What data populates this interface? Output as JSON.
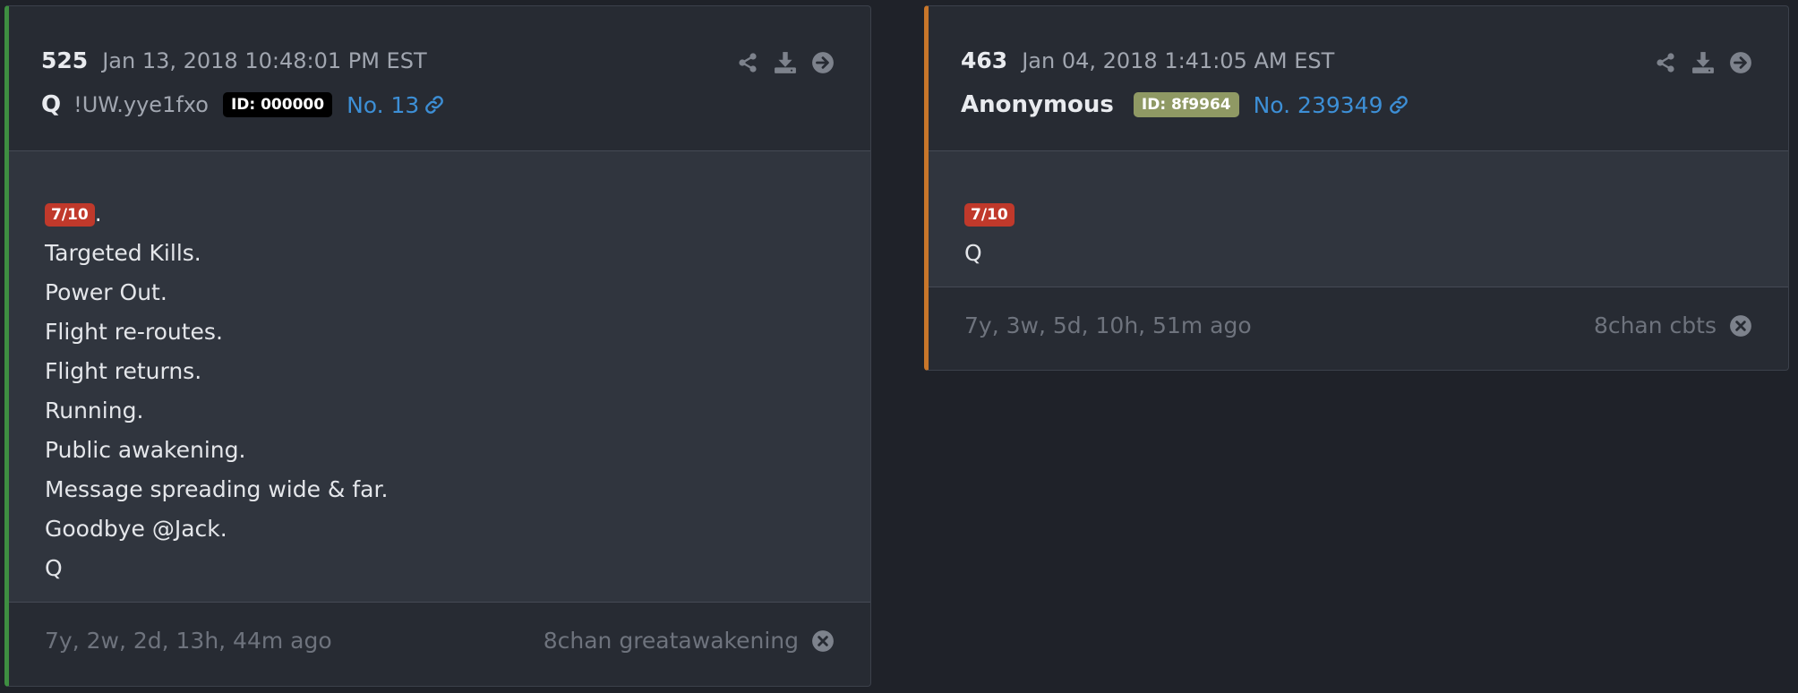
{
  "posts": [
    {
      "number": "525",
      "date": "Jan 13, 2018 10:48:01 PM EST",
      "author": "Q",
      "tripcode": "!UW.yye1fxo",
      "id_label": "ID: 000000",
      "id_color": "#000000",
      "post_no": "No. 13",
      "accent_color": "#3e8e41",
      "tag": "7/10",
      "tag_suffix": ".",
      "tag_color": "#c0392b",
      "lines": [
        "Targeted Kills.",
        "Power Out.",
        "Flight re-routes.",
        "Flight returns.",
        "Running.",
        "Public awakening.",
        "Message spreading wide & far.",
        "Goodbye @Jack.",
        "Q"
      ],
      "ago": "7y, 2w, 2d, 13h, 44m ago",
      "source": "8chan greatawakening"
    },
    {
      "number": "463",
      "date": "Jan 04, 2018 1:41:05 AM EST",
      "author": "Anonymous",
      "id_label": "ID: 8f9964",
      "id_color": "#8f9964",
      "post_no": "No. 239349",
      "accent_color": "#c8762a",
      "tag": "7/10",
      "tag_color": "#c0392b",
      "lines": [
        "Q"
      ],
      "ago": "7y, 3w, 5d, 10h, 51m ago",
      "source": "8chan cbts"
    }
  ],
  "icons": {
    "share": "share-icon",
    "download": "download-icon",
    "open": "arrow-right-circle-icon",
    "link": "link-icon",
    "close": "close-circle-icon"
  },
  "colors": {
    "background": "#1f2229",
    "card": "#272b33",
    "card_body": "#30353e",
    "link": "#3d8fd6",
    "muted": "#6e737d",
    "icon": "#7d828c"
  }
}
